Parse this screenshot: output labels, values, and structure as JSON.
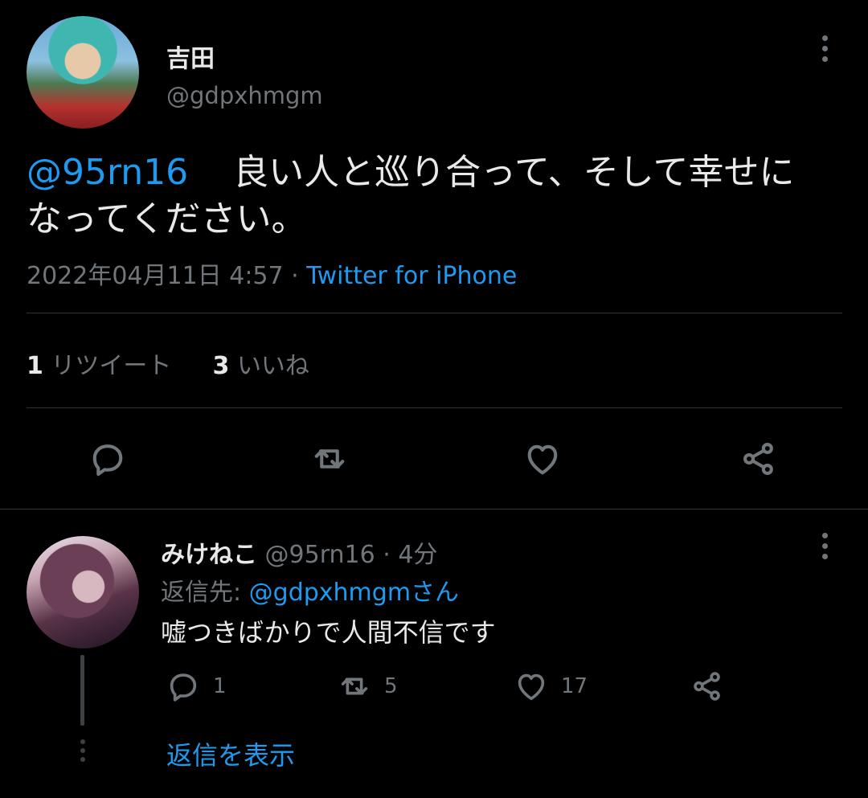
{
  "tweet": {
    "author_name": "吉田",
    "author_handle": "@gdpxhmgm",
    "mention": "@95rn16",
    "text_line1": "良い人と巡り合って、そして幸せに",
    "text_line2": "なってください。",
    "timestamp": "2022年04月11日 4:57",
    "separator": " · ",
    "source": "Twitter for iPhone",
    "retweet_count": "1",
    "retweet_label": "リツイート",
    "like_count": "3",
    "like_label": "いいね"
  },
  "reply": {
    "author_name": "みけねこ",
    "author_handle": "@95rn16",
    "time": "· 4分",
    "reply_to_prefix": "返信先: ",
    "reply_to_handle": "@gdpxhmgmさん",
    "text": "嘘つきばかりで人間不信です",
    "reply_count": "1",
    "retweet_count": "5",
    "like_count": "17"
  },
  "show_replies_label": "返信を表示",
  "colors": {
    "accent": "#1d9bf0",
    "muted": "#71767b",
    "background": "#000000"
  }
}
